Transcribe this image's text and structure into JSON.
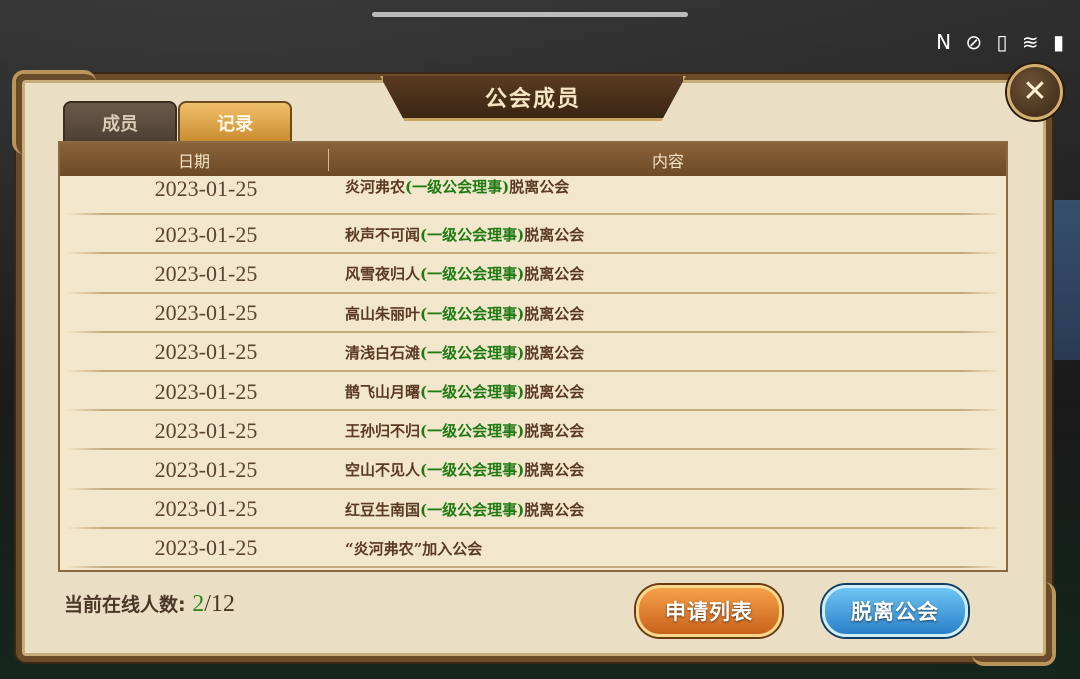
{
  "status": {
    "icons_text": "N ⊘ ▯ ≋ ▮"
  },
  "panel": {
    "title": "公会成员",
    "close_label": "✕",
    "tabs": [
      {
        "label": "成员",
        "active": false
      },
      {
        "label": "记录",
        "active": true
      }
    ],
    "table": {
      "headers": {
        "date": "日期",
        "content": "内容"
      },
      "rows": [
        {
          "date": "2023-01-25",
          "name": "炎河弗农",
          "role": "(一级公会理事)",
          "action": "脱离公会"
        },
        {
          "date": "2023-01-25",
          "name": "秋声不可闻",
          "role": "(一级公会理事)",
          "action": "脱离公会"
        },
        {
          "date": "2023-01-25",
          "name": "风雪夜归人",
          "role": "(一级公会理事)",
          "action": "脱离公会"
        },
        {
          "date": "2023-01-25",
          "name": "高山朱丽叶",
          "role": "(一级公会理事)",
          "action": "脱离公会"
        },
        {
          "date": "2023-01-25",
          "name": "清浅白石滩",
          "role": "(一级公会理事)",
          "action": "脱离公会"
        },
        {
          "date": "2023-01-25",
          "name": "鹊飞山月曙",
          "role": "(一级公会理事)",
          "action": "脱离公会"
        },
        {
          "date": "2023-01-25",
          "name": "王孙归不归",
          "role": "(一级公会理事)",
          "action": "脱离公会"
        },
        {
          "date": "2023-01-25",
          "name": "空山不见人",
          "role": "(一级公会理事)",
          "action": "脱离公会"
        },
        {
          "date": "2023-01-25",
          "name": "红豆生南国",
          "role": "(一级公会理事)",
          "action": "脱离公会"
        },
        {
          "date": "2023-01-25",
          "name": "“炎河弗农”",
          "role": "",
          "action": "加入公会"
        }
      ]
    },
    "online": {
      "label": "当前在线人数:",
      "count": "2",
      "total": "/12"
    },
    "buttons": {
      "apply_list": "申请列表",
      "leave_guild": "脱离公会"
    }
  },
  "colors": {
    "role_green": "#1f7a14",
    "apply_orange": "#e07f2c",
    "leave_blue": "#3d94d8"
  }
}
